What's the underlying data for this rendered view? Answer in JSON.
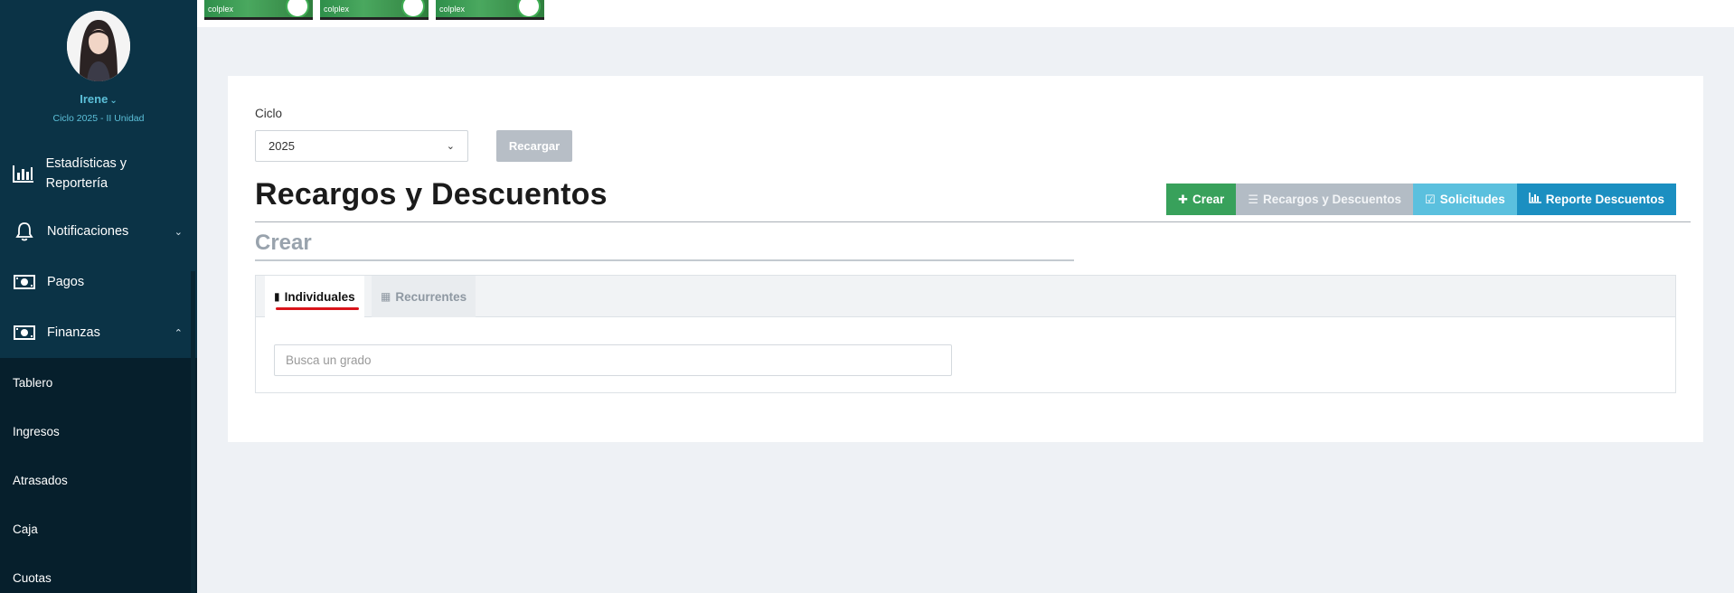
{
  "sidebar": {
    "user_name": "Irene",
    "cycle": "Ciclo 2025 - II Unidad",
    "items": [
      {
        "label": "Estadísticas y Reportería",
        "icon": "bar-chart-icon"
      },
      {
        "label": "Notificaciones",
        "icon": "bell-icon",
        "expanded": false
      },
      {
        "label": "Pagos",
        "icon": "money-icon"
      },
      {
        "label": "Finanzas",
        "icon": "money-icon",
        "expanded": true
      }
    ],
    "subitems": [
      "Tablero",
      "Ingresos",
      "Atrasados",
      "Caja",
      "Cuotas"
    ]
  },
  "topbar": {
    "banners": [
      "colplex",
      "colplex",
      "colplex"
    ]
  },
  "filter": {
    "label": "Ciclo",
    "selected": "2025",
    "reload_label": "Recargar"
  },
  "page": {
    "title": "Recargos y Descuentos",
    "subtitle": "Crear"
  },
  "toolbar": {
    "create": "Crear",
    "list": "Recargos y Descuentos",
    "requests": "Solicitudes",
    "report": "Reporte Descuentos"
  },
  "tabs": {
    "individual": "Individuales",
    "recurring": "Recurrentes"
  },
  "search": {
    "placeholder": "Busca un grado"
  },
  "colors": {
    "sidebar": "#0b3346",
    "accent_green": "#38a15b",
    "accent_blue": "#1b8fc1",
    "accent_lightblue": "#5bc0de",
    "tab_underline": "#d9141b"
  }
}
